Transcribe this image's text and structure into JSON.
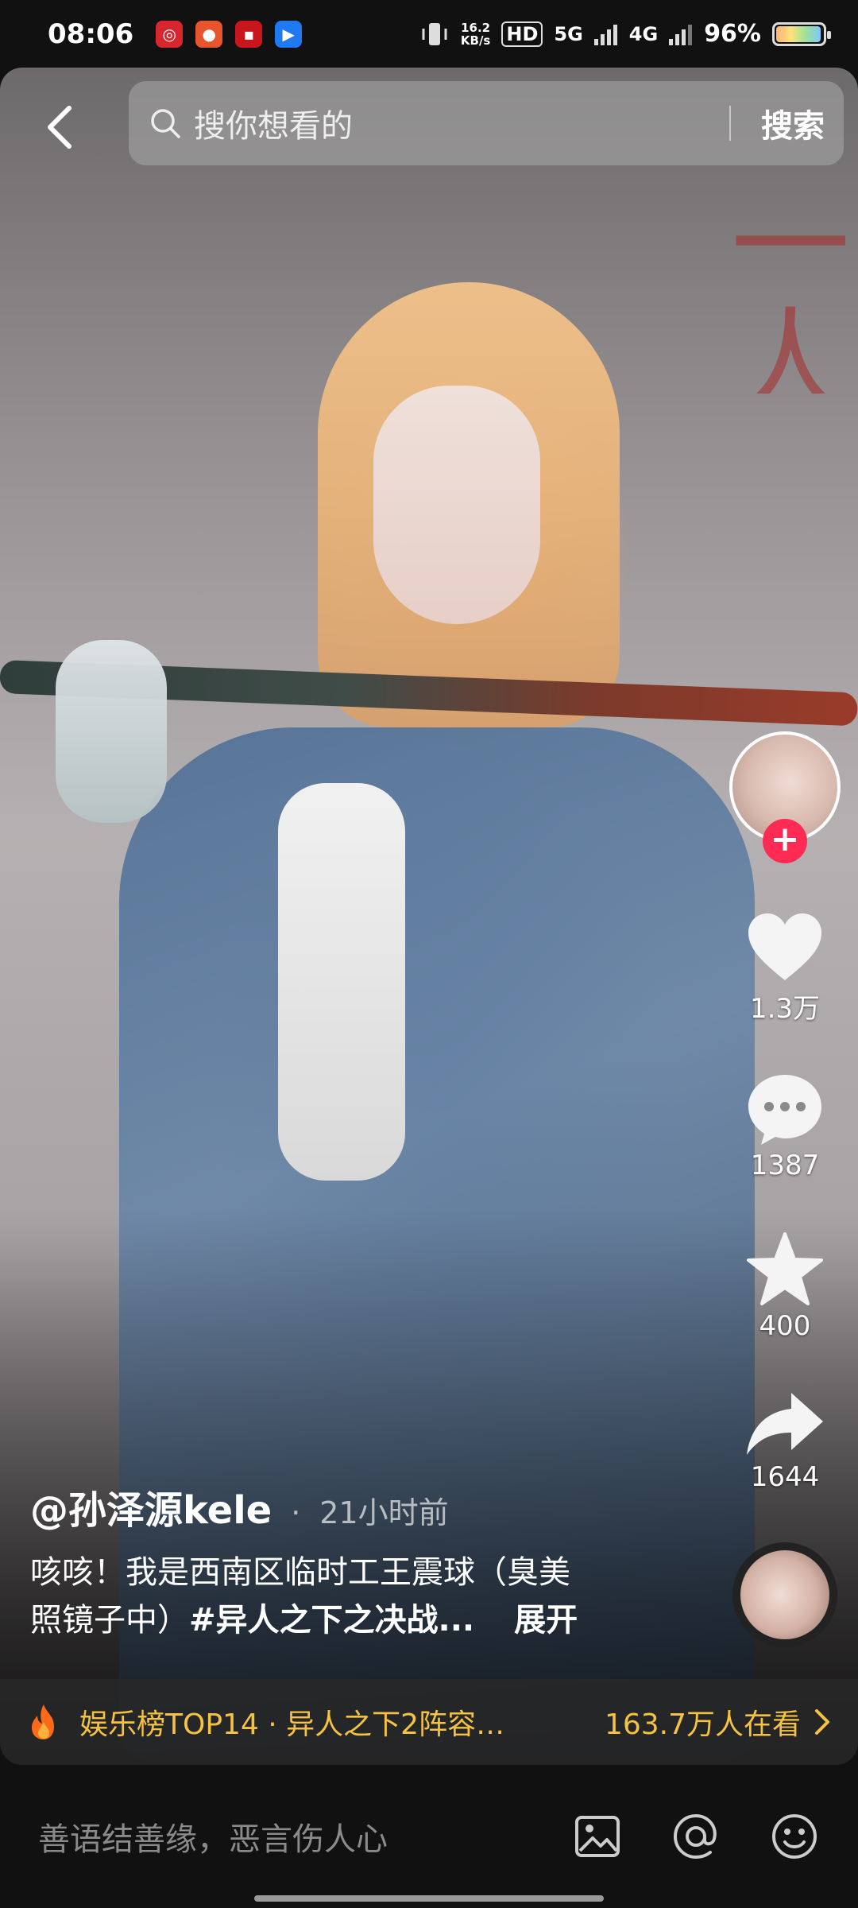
{
  "status_bar": {
    "time": "08:06",
    "network_speed_value": "16.2",
    "network_speed_unit": "KB/s",
    "hd_label": "HD",
    "signal_5g": "5G",
    "signal_4g": "4G",
    "battery_percent": "96%",
    "battery_level": 0.96
  },
  "search": {
    "placeholder": "搜你想看的",
    "submit_label": "搜索"
  },
  "watermark_text": "一人之下",
  "actions": {
    "like_count": "1.3万",
    "comment_count": "1387",
    "favorite_count": "400",
    "share_count": "1644",
    "follow_label": "+"
  },
  "caption": {
    "author": "@孙泽源kele",
    "separator": "·",
    "time_ago": "21小时前",
    "text_line1": "咳咳！我是西南区临时工王震球（臭美",
    "text_line2_prefix": "照镜子中）",
    "hashtag": "#异人之下之决战...",
    "expand_label": "展开"
  },
  "trend": {
    "label": "娱乐榜TOP14 · 异人之下2阵容…",
    "viewers": "163.7万人在看"
  },
  "comment_bar": {
    "placeholder": "善语结善缘，恶言伤人心"
  },
  "colors": {
    "accent_red": "#fe2c55",
    "trend_gold": "#f5c242"
  },
  "icons": {
    "back": "chevron-left-icon",
    "search": "search-icon",
    "like": "heart-icon",
    "comment": "comment-dots-icon",
    "favorite": "star-icon",
    "share": "share-arrow-icon",
    "trend": "fire-icon",
    "image": "image-icon",
    "mention": "at-icon",
    "emoji": "emoji-icon"
  }
}
